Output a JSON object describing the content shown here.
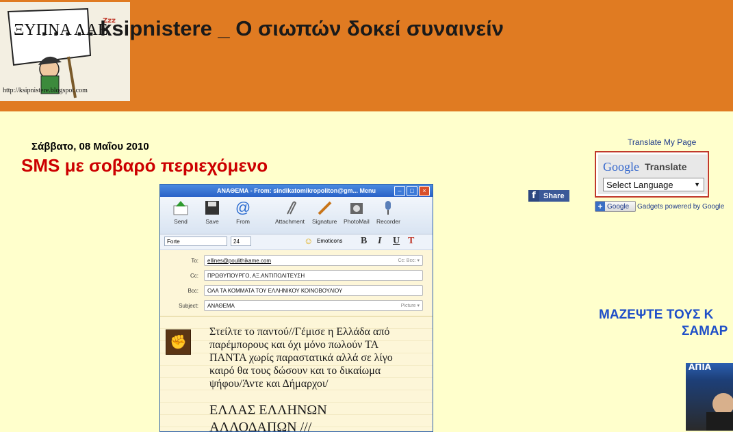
{
  "header": {
    "blog_title": ". . . . . ksipnistere _ Ο σιωπών δοκεί συναινείν",
    "logo": {
      "text_main": "ΞΥΠΝΑ ΛΑΕ",
      "url_text": "http://ksipnistere.blogspot.com",
      "zzz": "Zzz"
    }
  },
  "post": {
    "date": "Σάββατο, 08 Μαΐου 2010",
    "title": "SMS με σοβαρό περιεχόμενο",
    "share_label": "Share",
    "share_icon": "f"
  },
  "email_window": {
    "title": "ΑΝΑΘΕΜΑ - From: sindikatomikropoliton@gm...",
    "menu_label": "Menu",
    "toolbar": [
      {
        "label": "Send",
        "icon": "send-icon"
      },
      {
        "label": "Save",
        "icon": "save-icon"
      },
      {
        "label": "From",
        "icon": "at-icon"
      },
      {
        "label": "Attachment",
        "icon": "paperclip-icon"
      },
      {
        "label": "Signature",
        "icon": "pen-icon"
      },
      {
        "label": "PhotoMail",
        "icon": "photo-icon"
      },
      {
        "label": "Recorder",
        "icon": "microphone-icon"
      }
    ],
    "font_name": "Forte",
    "font_size": "24",
    "emoticons_label": "Emoticons",
    "format_buttons": [
      "B",
      "I",
      "U",
      "T"
    ],
    "fields": {
      "to_label": "To:",
      "to_value": "ellines@poulithikame.com",
      "to_hint": "Cc: Bcc: ▾",
      "cc_label": "Cc:",
      "cc_value": "ΠΡΩΘΥΠΟΥΡΓΟ, ΑΞ.ΑΝΤΙΠΟΛΙΤΕΥΣΗ",
      "bcc_label": "Bcc:",
      "bcc_value": "ΟΛΑ ΤΑ ΚΟΜΜΑΤΑ ΤΟΥ ΕΛΛΗΝΙΚΟΥ ΚΟΙΝΟΒΟΥΛΙΟΥ",
      "subject_label": "Subject:",
      "subject_value": "ΑΝΑΘΕΜΑ",
      "subject_hint": "Picture ▾"
    },
    "message": "Στείλτε το παντού//Γέμισε η Ελλάδα από παρέμπορους και όχι μόνο πωλούν ΤΑ ΠΑΝΤΑ χωρίς παραστατικά αλλά σε λίγο καιρό θα τους δώσουν και το δικαίωμα ψήφου/Άντε και Δήμαρχοι/",
    "message2": "ΕΛΛΑΣ ΕΛΛΗΝΩΝ",
    "message3": "ΑΛΛΟΔΑΠΩΝ ///"
  },
  "sidebar": {
    "translate_label": "Translate My Page",
    "google_translate": {
      "google": "Google",
      "translate": "Translate",
      "select": "Select Language"
    },
    "gadgets_badge": "Google",
    "gadgets_text": "Gadgets powered by Google",
    "heading_line1": "ΜΑΖΕΨΤΕ ΤΟΥΣ Κ",
    "heading_line2": "ΣΑΜΑΡ",
    "image_text": "ΑΠΙΑ"
  },
  "colors": {
    "header_bg": "#e07b22",
    "page_bg": "#ffffcc",
    "post_title": "#cc0000",
    "sidebar_heading": "#1f4fc8"
  }
}
